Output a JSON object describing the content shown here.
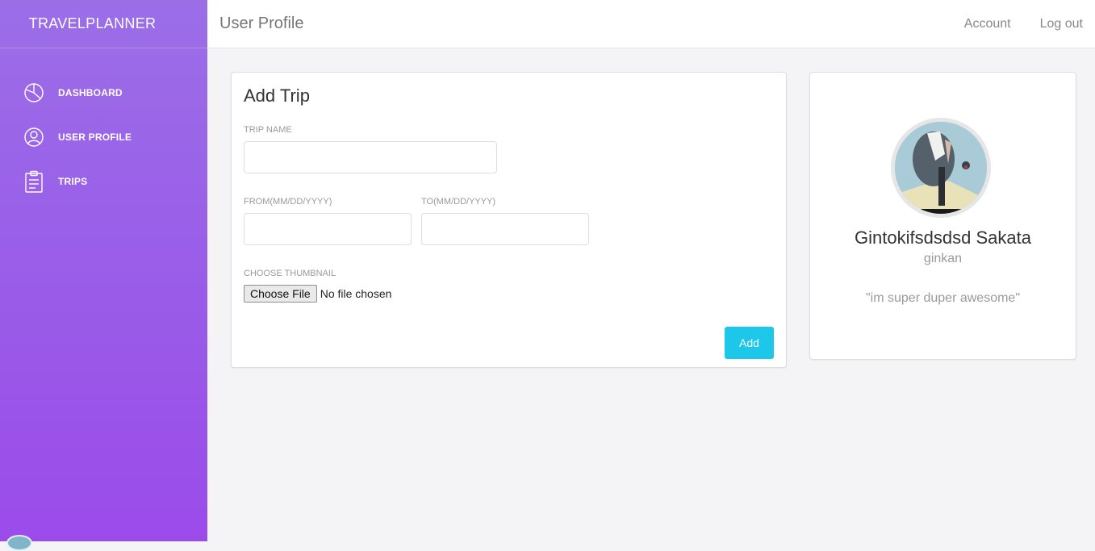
{
  "sidebar": {
    "brand": "TRAVELPLANNER",
    "items": [
      {
        "label": "DASHBOARD",
        "icon": "pie-chart-icon"
      },
      {
        "label": "USER PROFILE",
        "icon": "user-icon"
      },
      {
        "label": "TRIPS",
        "icon": "clipboard-icon"
      }
    ]
  },
  "header": {
    "title": "User Profile",
    "account_link": "Account",
    "logout_link": "Log out"
  },
  "add_trip": {
    "title": "Add Trip",
    "trip_name_label": "TRIP NAME",
    "trip_name_value": "",
    "from_label": "FROM(MM/DD/YYYY)",
    "from_value": "",
    "to_label": "TO(MM/DD/YYYY)",
    "to_value": "",
    "thumbnail_label": "CHOOSE THUMBNAIL",
    "choose_file_label": "Choose File",
    "file_status": "No file chosen",
    "add_button": "Add"
  },
  "profile": {
    "name": "Gintokifsdsdsd Sakata",
    "username": "ginkan",
    "bio": "\"im super duper awesome\""
  },
  "colors": {
    "sidebar_top": "#9b6ee8",
    "sidebar_bottom": "#9b4bea",
    "accent_button": "#1dc7ea"
  }
}
